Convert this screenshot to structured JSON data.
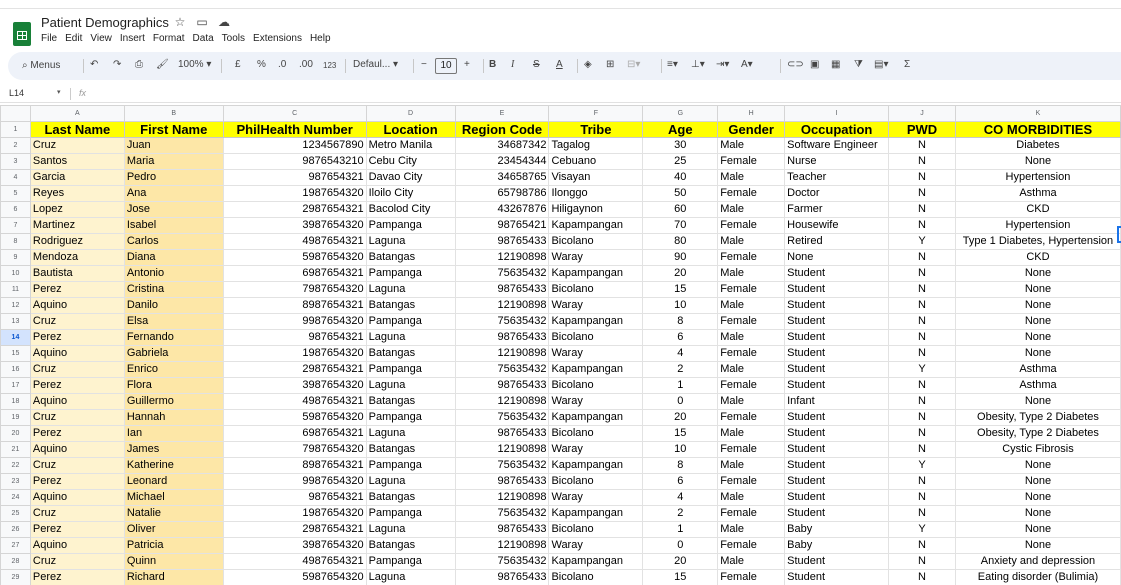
{
  "app": {
    "doc_title": "Patient Demographics",
    "menus": [
      "File",
      "Edit",
      "View",
      "Insert",
      "Format",
      "Data",
      "Tools",
      "Extensions",
      "Help"
    ]
  },
  "toolbar": {
    "menus_label": "Menus",
    "zoom": "100%",
    "currency": "£",
    "percent": "%",
    "dec_decrease": ".0",
    "dec_increase": ".00",
    "number_format": "123",
    "font": "Defaul...",
    "font_size": "10",
    "bold": "B",
    "italic": "I",
    "strike": "S",
    "text_color": "A",
    "sum": "Σ",
    "minus": "−",
    "plus": "+"
  },
  "formula_bar": {
    "cell_ref": "L14",
    "fx": "fx"
  },
  "sheet": {
    "columns": [
      "A",
      "B",
      "C",
      "D",
      "E",
      "F",
      "G",
      "H",
      "I",
      "J",
      "K"
    ],
    "headers": [
      "Last Name",
      "First Name",
      "PhilHealth Number",
      "Location",
      "Region Code",
      "Tribe",
      "Age",
      "Gender",
      "Occupation",
      "PWD",
      "CO MORBIDITIES"
    ],
    "selected_row": 14,
    "rows": [
      [
        "Cruz",
        "Juan",
        "1234567890",
        "Metro Manila",
        "34687342",
        "Tagalog",
        "30",
        "Male",
        "Software Engineer",
        "N",
        "Diabetes"
      ],
      [
        "Santos",
        "Maria",
        "9876543210",
        "Cebu City",
        "23454344",
        "Cebuano",
        "25",
        "Female",
        "Nurse",
        "N",
        "None"
      ],
      [
        "Garcia",
        "Pedro",
        "987654321",
        "Davao City",
        "34658765",
        "Visayan",
        "40",
        "Male",
        "Teacher",
        "N",
        "Hypertension"
      ],
      [
        "Reyes",
        "Ana",
        "1987654320",
        "Iloilo City",
        "65798786",
        "Ilonggo",
        "50",
        "Female",
        "Doctor",
        "N",
        "Asthma"
      ],
      [
        "Lopez",
        "Jose",
        "2987654321",
        "Bacolod City",
        "43267876",
        "Hiligaynon",
        "60",
        "Male",
        "Farmer",
        "N",
        "CKD"
      ],
      [
        "Martinez",
        "Isabel",
        "3987654320",
        "Pampanga",
        "98765421",
        "Kapampangan",
        "70",
        "Female",
        "Housewife",
        "N",
        "Hypertension"
      ],
      [
        "Rodriguez",
        "Carlos",
        "4987654321",
        "Laguna",
        "98765433",
        "Bicolano",
        "80",
        "Male",
        "Retired",
        "Y",
        "Type 1 Diabetes, Hypertension"
      ],
      [
        "Mendoza",
        "Diana",
        "5987654320",
        "Batangas",
        "12190898",
        "Waray",
        "90",
        "Female",
        "None",
        "N",
        "CKD"
      ],
      [
        "Bautista",
        "Antonio",
        "6987654321",
        "Pampanga",
        "75635432",
        "Kapampangan",
        "20",
        "Male",
        "Student",
        "N",
        "None"
      ],
      [
        "Perez",
        "Cristina",
        "7987654320",
        "Laguna",
        "98765433",
        "Bicolano",
        "15",
        "Female",
        "Student",
        "N",
        "None"
      ],
      [
        "Aquino",
        "Danilo",
        "8987654321",
        "Batangas",
        "12190898",
        "Waray",
        "10",
        "Male",
        "Student",
        "N",
        "None"
      ],
      [
        "Cruz",
        "Elsa",
        "9987654320",
        "Pampanga",
        "75635432",
        "Kapampangan",
        "8",
        "Female",
        "Student",
        "N",
        "None"
      ],
      [
        "Perez",
        "Fernando",
        "987654321",
        "Laguna",
        "98765433",
        "Bicolano",
        "6",
        "Male",
        "Student",
        "N",
        "None"
      ],
      [
        "Aquino",
        "Gabriela",
        "1987654320",
        "Batangas",
        "12190898",
        "Waray",
        "4",
        "Female",
        "Student",
        "N",
        "None"
      ],
      [
        "Cruz",
        "Enrico",
        "2987654321",
        "Pampanga",
        "75635432",
        "Kapampangan",
        "2",
        "Male",
        "Student",
        "Y",
        "Asthma"
      ],
      [
        "Perez",
        "Flora",
        "3987654320",
        "Laguna",
        "98765433",
        "Bicolano",
        "1",
        "Female",
        "Student",
        "N",
        "Asthma"
      ],
      [
        "Aquino",
        "Guillermo",
        "4987654321",
        "Batangas",
        "12190898",
        "Waray",
        "0",
        "Male",
        "Infant",
        "N",
        "None"
      ],
      [
        "Cruz",
        "Hannah",
        "5987654320",
        "Pampanga",
        "75635432",
        "Kapampangan",
        "20",
        "Female",
        "Student",
        "N",
        "Obesity, Type 2 Diabetes"
      ],
      [
        "Perez",
        "Ian",
        "6987654321",
        "Laguna",
        "98765433",
        "Bicolano",
        "15",
        "Male",
        "Student",
        "N",
        "Obesity, Type 2 Diabetes"
      ],
      [
        "Aquino",
        "James",
        "7987654320",
        "Batangas",
        "12190898",
        "Waray",
        "10",
        "Female",
        "Student",
        "N",
        "Cystic Fibrosis"
      ],
      [
        "Cruz",
        "Katherine",
        "8987654321",
        "Pampanga",
        "75635432",
        "Kapampangan",
        "8",
        "Male",
        "Student",
        "Y",
        "None"
      ],
      [
        "Perez",
        "Leonard",
        "9987654320",
        "Laguna",
        "98765433",
        "Bicolano",
        "6",
        "Female",
        "Student",
        "N",
        "None"
      ],
      [
        "Aquino",
        "Michael",
        "987654321",
        "Batangas",
        "12190898",
        "Waray",
        "4",
        "Male",
        "Student",
        "N",
        "None"
      ],
      [
        "Cruz",
        "Natalie",
        "1987654320",
        "Pampanga",
        "75635432",
        "Kapampangan",
        "2",
        "Female",
        "Student",
        "N",
        "None"
      ],
      [
        "Perez",
        "Oliver",
        "2987654321",
        "Laguna",
        "98765433",
        "Bicolano",
        "1",
        "Male",
        "Baby",
        "Y",
        "None"
      ],
      [
        "Aquino",
        "Patricia",
        "3987654320",
        "Batangas",
        "12190898",
        "Waray",
        "0",
        "Female",
        "Baby",
        "N",
        "None"
      ],
      [
        "Cruz",
        "Quinn",
        "4987654321",
        "Pampanga",
        "75635432",
        "Kapampangan",
        "20",
        "Male",
        "Student",
        "N",
        "Anxiety and depression"
      ],
      [
        "Perez",
        "Richard",
        "5987654320",
        "Laguna",
        "98765433",
        "Bicolano",
        "15",
        "Female",
        "Student",
        "N",
        "Eating disorder (Bulimia)"
      ]
    ]
  }
}
